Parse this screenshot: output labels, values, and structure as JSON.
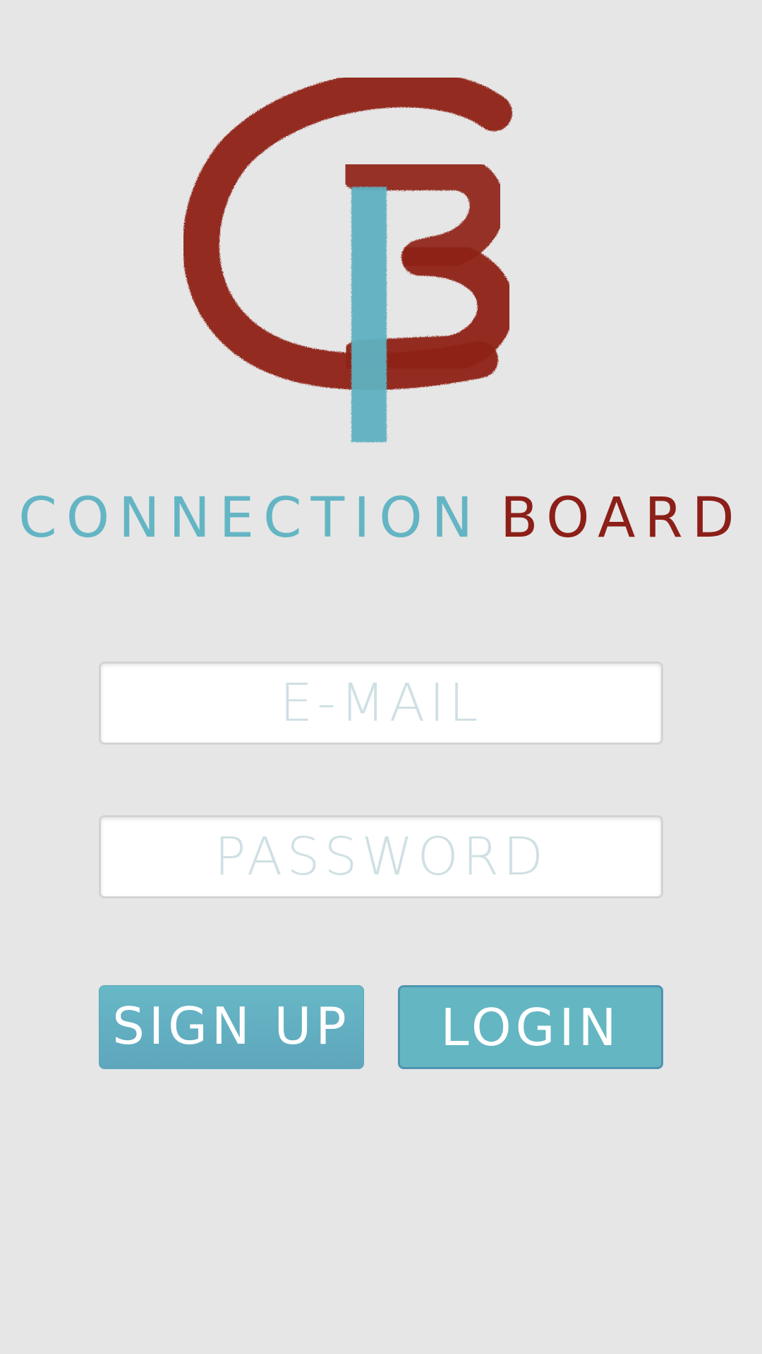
{
  "app": {
    "brand_word_1": "CONNECTION",
    "brand_word_2": "BOARD",
    "logo_icon": "cb-brush-logo-icon"
  },
  "form": {
    "email_placeholder": "E-MAIL",
    "email_value": "",
    "password_placeholder": "PASSWORD",
    "password_value": ""
  },
  "actions": {
    "signup_label": "SIGN UP",
    "login_label": "LOGIN"
  },
  "colors": {
    "background": "#e6e6e6",
    "brand_teal": "#64b5c4",
    "brand_red": "#8c1f18",
    "placeholder": "#cfe0e4",
    "button_border_login": "#4e94b1"
  }
}
